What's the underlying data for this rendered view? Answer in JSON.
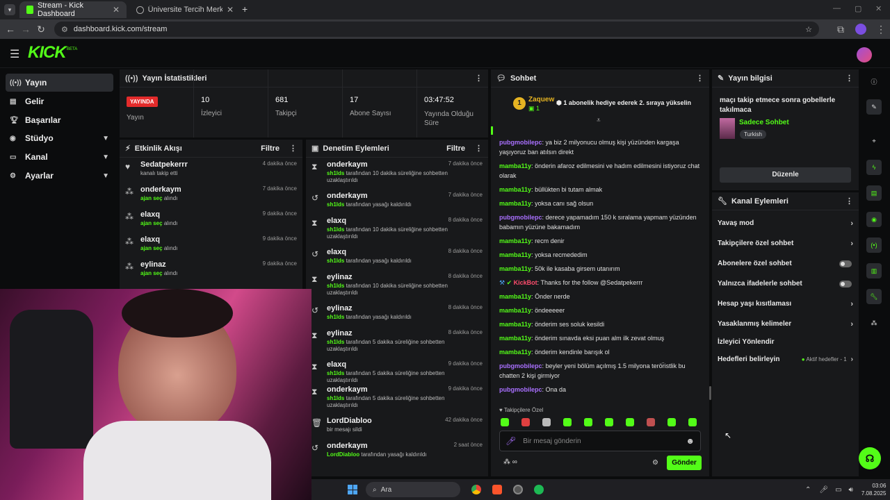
{
  "browser": {
    "tabs": [
      {
        "label": "Stream - Kick Dashboard",
        "active": true
      },
      {
        "label": "Üniversite Tercih Merkezi | Üniv",
        "active": false
      }
    ],
    "url": "dashboard.kick.com/stream"
  },
  "kick": {
    "logo": "KICK",
    "beta": "BETA"
  },
  "sidebar": {
    "items": [
      {
        "label": "Yayın",
        "icon": "broadcast-icon"
      },
      {
        "label": "Gelir",
        "icon": "revenue-icon"
      },
      {
        "label": "Başarılar",
        "icon": "trophy-icon"
      },
      {
        "label": "Stüdyo",
        "icon": "studio-icon"
      },
      {
        "label": "Kanal",
        "icon": "channel-icon"
      },
      {
        "label": "Ayarlar",
        "icon": "gear-icon"
      }
    ]
  },
  "stats": {
    "title": "Yayın İstatistikleri",
    "live_badge": "YAYINDA",
    "live_label": "Yayın",
    "items": [
      {
        "value": "10",
        "label": "İzleyici"
      },
      {
        "value": "681",
        "label": "Takipçi"
      },
      {
        "value": "17",
        "label": "Abone Sayısı"
      },
      {
        "value": "03:47:52",
        "label": "Yayında Olduğu Süre"
      }
    ]
  },
  "activity": {
    "title": "Etkinlik Akışı",
    "filter": "Filtre",
    "rows": [
      {
        "name": "Sedatpekerrr",
        "sub": "kanalı takip etti",
        "green": "",
        "time": "4 dakika önce",
        "icon": "heart-icon"
      },
      {
        "name": "onderkaym",
        "green": "ajan seç",
        "sub": "alındı",
        "time": "7 dakika önce",
        "icon": "kick-points-icon"
      },
      {
        "name": "elaxq",
        "green": "ajan seç",
        "sub": "alındı",
        "time": "9 dakika önce",
        "icon": "kick-points-icon"
      },
      {
        "name": "elaxq",
        "green": "ajan seç",
        "sub": "alındı",
        "time": "9 dakika önce",
        "icon": "kick-points-icon"
      },
      {
        "name": "eylinaz",
        "green": "ajan seç",
        "sub": "alındı",
        "time": "9 dakika önce",
        "icon": "kick-points-icon"
      }
    ]
  },
  "moderation": {
    "title": "Denetim Eylemleri",
    "filter": "Filtre",
    "rows": [
      {
        "name": "onderkaym",
        "green": "sh1lds",
        "sub": "tarafından 10 dakika süreliğine sohbetten uzaklaştırıldı",
        "time": "7 dakika önce",
        "icon": "hourglass-icon"
      },
      {
        "name": "onderkaym",
        "green": "sh1lds",
        "sub": "tarafından yasağı kaldırıldı",
        "time": "7 dakika önce",
        "icon": "undo-icon"
      },
      {
        "name": "elaxq",
        "green": "sh1lds",
        "sub": "tarafından 10 dakika süreliğine sohbetten uzaklaştırıldı",
        "time": "8 dakika önce",
        "icon": "hourglass-icon"
      },
      {
        "name": "elaxq",
        "green": "sh1lds",
        "sub": "tarafından yasağı kaldırıldı",
        "time": "8 dakika önce",
        "icon": "undo-icon"
      },
      {
        "name": "eylinaz",
        "green": "sh1lds",
        "sub": "tarafından 10 dakika süreliğine sohbetten uzaklaştırıldı",
        "time": "8 dakika önce",
        "icon": "hourglass-icon"
      },
      {
        "name": "eylinaz",
        "green": "sh1lds",
        "sub": "tarafından yasağı kaldırıldı",
        "time": "8 dakika önce",
        "icon": "undo-icon"
      },
      {
        "name": "eylinaz",
        "green": "sh1lds",
        "sub": "tarafından 5 dakika süreliğine sohbetten uzaklaştırıldı",
        "time": "8 dakika önce",
        "icon": "hourglass-icon"
      },
      {
        "name": "elaxq",
        "green": "sh1lds",
        "sub": "tarafından 5 dakika süreliğine sohbetten uzaklaştırıldı",
        "time": "9 dakika önce",
        "icon": "hourglass-icon"
      },
      {
        "name": "onderkaym",
        "green": "sh1lds",
        "sub": "tarafından 5 dakika süreliğine sohbetten uzaklaştırıldı",
        "time": "9 dakika önce",
        "icon": "hourglass-icon"
      },
      {
        "name": "LordDiabloo",
        "green": "",
        "sub": "bir mesajı sildi",
        "time": "42 dakika önce",
        "icon": "trash-icon"
      },
      {
        "name": "onderkaym",
        "green": "LordDiabloo",
        "sub": "tarafından yasağı kaldırıldı",
        "time": "2 saat önce",
        "icon": "undo-icon"
      }
    ]
  },
  "chat": {
    "title": "Sohbet",
    "pinned_user": "Zaquew",
    "pinned_count": "1",
    "pinned_msg": "1 abonelik hediye ederek 2. sıraya yükselin",
    "messages": [
      {
        "user": "pubgmobilepc",
        "color": "#a970ff",
        "text": "ya biz 2 milyonucu olmuş kişi yüzünden kargaşa yaşıyoruz ban atılsın direkt"
      },
      {
        "user": "mamba11y",
        "color": "#53fc18",
        "text": "önderin afaroz edilmesini ve hadım edilmesini istiyoruz chat olarak"
      },
      {
        "user": "mamba11y",
        "color": "#53fc18",
        "text": "büllükten bi tutam almak"
      },
      {
        "user": "mamba11y",
        "color": "#53fc18",
        "text": "yoksa canı sağ olsun"
      },
      {
        "user": "pubgmobilepc",
        "color": "#a970ff",
        "text": "derece yapamadım 150 k sıralama yapmam yüzünden babamın yüzüne bakamadım"
      },
      {
        "user": "mamba11y",
        "color": "#53fc18",
        "text": "recm denir"
      },
      {
        "user": "mamba11y",
        "color": "#53fc18",
        "text": "yoksa recmededim"
      },
      {
        "user": "mamba11y",
        "color": "#53fc18",
        "text": "50k ile kasaba girsem utanırım"
      },
      {
        "user": "KickBot",
        "color": "#ff4d6d",
        "text": "Thanks for the follow @Sedatpekerrr"
      },
      {
        "user": "mamba11y",
        "color": "#53fc18",
        "text": "Önder nerde"
      },
      {
        "user": "mamba11y",
        "color": "#53fc18",
        "text": "öndeeeeer"
      },
      {
        "user": "mamba11y",
        "color": "#53fc18",
        "text": "önderim ses soluk kesildi"
      },
      {
        "user": "mamba11y",
        "color": "#53fc18",
        "text": "önderim sınavda eksi puan alm ilk zevat olmuş"
      },
      {
        "user": "mamba11y",
        "color": "#53fc18",
        "text": "önderim kendinle barışık ol"
      },
      {
        "user": "pubgmobilepc",
        "color": "#a970ff",
        "text": "beyler yeni bölüm açılmış 1.5 milyona terör̈istlik bu chatten 2 kişi girmiyor"
      },
      {
        "user": "pubgmobilepc",
        "color": "#a970ff",
        "text": "Ona da"
      }
    ],
    "followers_only": "Takipçilere Özel",
    "placeholder": "Bir mesaj gönderin",
    "send": "Gönder",
    "points": "∞"
  },
  "info": {
    "title": "Yayın bilgisi",
    "stream_title": "maçı takip etmece sonra gobellerle takılmaca",
    "category": "Sadece Sohbet",
    "tag": "Turkish",
    "edit": "Düzenle"
  },
  "actions": {
    "title": "Kanal Eylemleri",
    "rows": [
      {
        "label": "Yavaş mod",
        "kind": "chevron"
      },
      {
        "label": "Takipçilere özel sohbet",
        "kind": "chevron"
      },
      {
        "label": "Abonelere özel sohbet",
        "kind": "toggle"
      },
      {
        "label": "Yalnızca ifadelerle sohbet",
        "kind": "toggle"
      },
      {
        "label": "Hesap yaşı kısıtlaması",
        "kind": "chevron"
      },
      {
        "label": "Yasaklanmış kelimeler",
        "kind": "chevron"
      },
      {
        "label": "İzleyici Yönlendir",
        "kind": "none"
      },
      {
        "label": "Hedefleri belirleyin",
        "kind": "chevron"
      }
    ],
    "goals_status": "Aktif hedefler - 1"
  },
  "taskbar": {
    "search": "Ara",
    "time": "03:06",
    "date": "7.08.2025"
  },
  "colors": {
    "accent": "#53fc18",
    "live": "#e32b2b",
    "panel": "#18191b",
    "bg": "#0b0c0d"
  }
}
